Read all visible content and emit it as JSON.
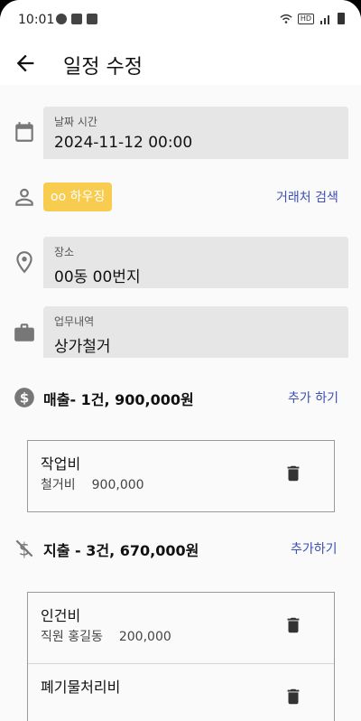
{
  "status_bar": {
    "time": "10:01",
    "icons_left": [
      "sms-icon",
      "instagram-icon",
      "gallery-icon"
    ],
    "hd_label": "HD"
  },
  "app_bar": {
    "title": "일정 수정"
  },
  "datetime": {
    "label": "날짜 시간",
    "value": "2024-11-12 00:00"
  },
  "client": {
    "chip": "oo 하우징",
    "search_link": "거래처 검색"
  },
  "location": {
    "label": "장소",
    "value": "00동 00번지"
  },
  "work": {
    "label": "업무내역",
    "value": "상가철거"
  },
  "sales": {
    "title": "매출- 1건, 900,000원",
    "add_link": "추가 하기",
    "items": [
      {
        "name": "작업비",
        "detail": "철거비",
        "amount": "900,000"
      }
    ]
  },
  "expense": {
    "title": "지출 - 3건, 670,000원",
    "add_link": "추가하기",
    "items": [
      {
        "name": "인건비",
        "detail": "직원 홍길동",
        "amount": "200,000"
      },
      {
        "name": "폐기물처리비",
        "detail": "",
        "amount": ""
      }
    ]
  }
}
